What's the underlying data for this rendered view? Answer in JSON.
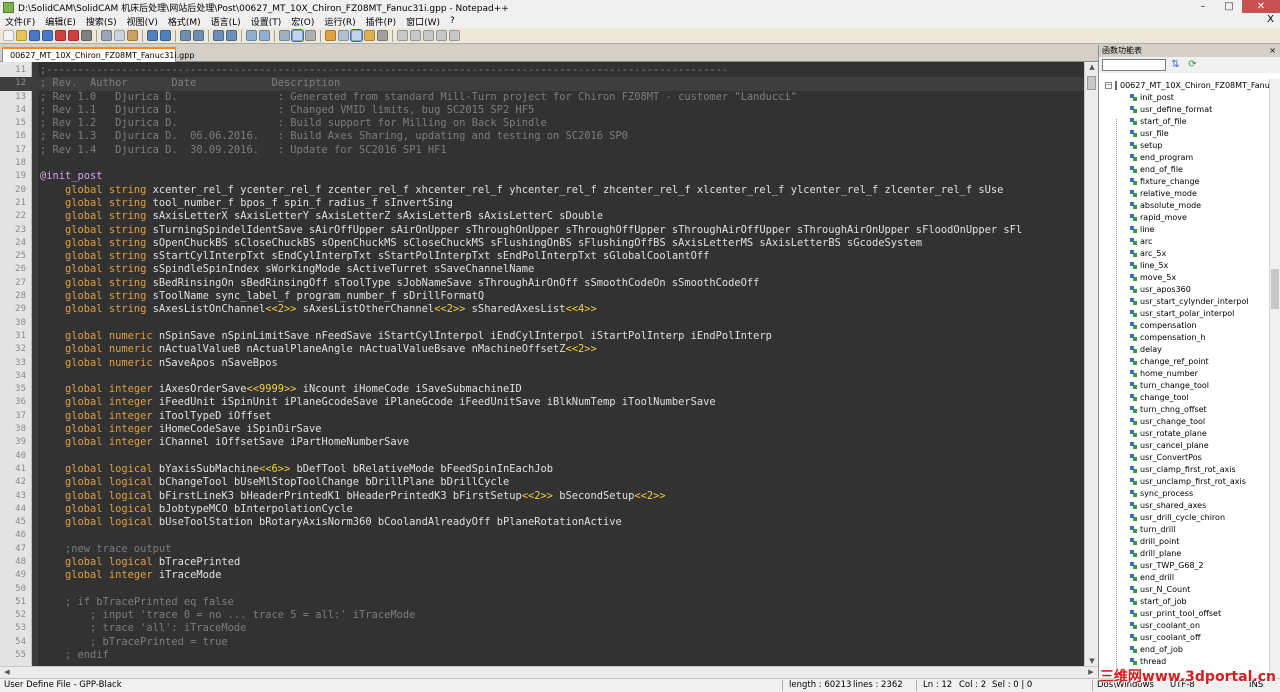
{
  "window": {
    "title": "D:\\SolidCAM\\SolidCAM 机床后处理\\网站后处理\\Post\\00627_MT_10X_Chiron_FZ08MT_Fanuc31i.gpp - Notepad++",
    "min": "–",
    "max": "□",
    "close": "✕"
  },
  "menu": {
    "items": [
      "文件(F)",
      "编辑(E)",
      "搜索(S)",
      "视图(V)",
      "格式(M)",
      "语言(L)",
      "设置(T)",
      "宏(O)",
      "运行(R)",
      "插件(P)",
      "窗口(W)",
      "?"
    ],
    "close": "X"
  },
  "toolbar": {
    "icons": [
      "new-file-icon",
      "open-file-icon",
      "save-icon",
      "save-all-icon",
      "close-icon",
      "close-all-icon",
      "print-icon",
      "sep",
      "cut-icon",
      "copy-icon",
      "paste-icon",
      "sep",
      "undo-icon",
      "redo-icon",
      "sep",
      "find-icon",
      "replace-icon",
      "sep",
      "zoom-in-icon",
      "zoom-out-icon",
      "sep",
      "sync-v-icon",
      "sync-h-icon",
      "sep",
      "wrap-icon",
      "all-chars-icon",
      "indent-guide-icon",
      "sep",
      "user-lang-icon",
      "doc-map-icon",
      "function-list-icon",
      "folder-workspace-icon",
      "monitor-icon",
      "sep",
      "record-macro-icon",
      "stop-record-icon",
      "play-macro-icon",
      "run-macro-icon",
      "save-macro-icon"
    ],
    "active": [
      "all-chars-icon",
      "function-list-icon"
    ],
    "colors": {
      "new-file-icon": "#f4f4f4",
      "open-file-icon": "#e8c45a",
      "save-icon": "#4a78c8",
      "save-all-icon": "#4a78c8",
      "close-icon": "#d04040",
      "close-all-icon": "#d04040",
      "print-icon": "#808080",
      "cut-icon": "#9aa4b4",
      "copy-icon": "#c9d3e4",
      "paste-icon": "#c8a060",
      "undo-icon": "#5080c0",
      "redo-icon": "#5080c0",
      "find-icon": "#7090b0",
      "replace-icon": "#7090b0",
      "zoom-in-icon": "#6a8fb8",
      "zoom-out-icon": "#6a8fb8",
      "sync-v-icon": "#8fb0d0",
      "sync-h-icon": "#8fb0d0",
      "wrap-icon": "#a0b0c0",
      "all-chars-icon": "#d0b060",
      "indent-guide-icon": "#b0b0b0",
      "user-lang-icon": "#e0a040",
      "doc-map-icon": "#b0c0d0",
      "function-list-icon": "#e8d090",
      "folder-workspace-icon": "#e0b050",
      "monitor-icon": "#a0a0a0",
      "record-macro-icon": "#c8c8c8",
      "stop-record-icon": "#c8c8c8",
      "play-macro-icon": "#c8c8c8",
      "run-macro-icon": "#c8c8c8",
      "save-macro-icon": "#c8c8c8"
    }
  },
  "tab": {
    "label": "00627_MT_10X_Chiron_FZ08MT_Fanuc31i.gpp"
  },
  "editor": {
    "lines": [
      {
        "n": "11",
        "segs": [
          [
            "comment",
            ";-------------------------------------------------------------------------------------------------------------"
          ]
        ]
      },
      {
        "n": "12",
        "current": true,
        "segs": [
          [
            "comment",
            "; Rev.  Author       Date            Description"
          ]
        ]
      },
      {
        "n": "13",
        "segs": [
          [
            "comment",
            "; Rev 1.0   Djurica D.                : Generated from standard Mill-Turn project for Chiron FZ08MT - customer \"Landucci\""
          ]
        ]
      },
      {
        "n": "14",
        "segs": [
          [
            "comment",
            "; Rev 1.1   Djurica D.                : Changed VMID limits, bug SC2015 SP2 HF5"
          ]
        ]
      },
      {
        "n": "15",
        "segs": [
          [
            "comment",
            "; Rev 1.2   Djurica D.                : Build support for Milling on Back Spindle"
          ]
        ]
      },
      {
        "n": "16",
        "segs": [
          [
            "comment",
            "; Rev 1.3   Djurica D.  06.06.2016.   : Build Axes Sharing, updating and testing on SC2016 SP0"
          ]
        ]
      },
      {
        "n": "17",
        "segs": [
          [
            "comment",
            "; Rev 1.4   Djurica D.  30.09.2016.   : Update for SC2016 SP1 HF1"
          ]
        ]
      },
      {
        "n": "18",
        "segs": []
      },
      {
        "n": "19",
        "segs": [
          [
            "section",
            "@init_post"
          ]
        ]
      },
      {
        "n": "20",
        "segs": [
          [
            "plain",
            "    "
          ],
          [
            "keyword",
            "global string"
          ],
          [
            "plain",
            " xcenter_rel_f ycenter_rel_f zcenter_rel_f xhcenter_rel_f yhcenter_rel_f zhcenter_rel_f xlcenter_rel_f ylcenter_rel_f zlcenter_rel_f sUse"
          ]
        ]
      },
      {
        "n": "21",
        "segs": [
          [
            "plain",
            "    "
          ],
          [
            "keyword",
            "global string"
          ],
          [
            "plain",
            " tool_number_f bpos_f spin_f radius_f sInvertSing"
          ]
        ]
      },
      {
        "n": "22",
        "segs": [
          [
            "plain",
            "    "
          ],
          [
            "keyword",
            "global string"
          ],
          [
            "plain",
            " sAxisLetterX sAxisLetterY sAxisLetterZ sAxisLetterB sAxisLetterC sDouble"
          ]
        ]
      },
      {
        "n": "23",
        "segs": [
          [
            "plain",
            "    "
          ],
          [
            "keyword",
            "global string"
          ],
          [
            "plain",
            " sTurningSpindelIdentSave sAirOffUpper sAirOnUpper sThroughOnUpper sThroughOffUpper sThroughAirOffUpper sThroughAirOnUpper sFloodOnUpper sFl"
          ]
        ]
      },
      {
        "n": "24",
        "segs": [
          [
            "plain",
            "    "
          ],
          [
            "keyword",
            "global string"
          ],
          [
            "plain",
            " sOpenChuckBS sCloseChuckBS sOpenChuckMS sCloseChuckMS sFlushingOnBS sFlushingOffBS sAxisLetterMS sAxisLetterBS sGcodeSystem"
          ]
        ]
      },
      {
        "n": "25",
        "segs": [
          [
            "plain",
            "    "
          ],
          [
            "keyword",
            "global string"
          ],
          [
            "plain",
            " sStartCylInterpTxt sEndCylInterpTxt sStartPolInterpTxt sEndPolInterpTxt sGlobalCoolantOff"
          ]
        ]
      },
      {
        "n": "26",
        "segs": [
          [
            "plain",
            "    "
          ],
          [
            "keyword",
            "global string"
          ],
          [
            "plain",
            " sSpindleSpinIndex sWorkingMode sActiveTurret sSaveChannelName"
          ]
        ]
      },
      {
        "n": "27",
        "segs": [
          [
            "plain",
            "    "
          ],
          [
            "keyword",
            "global string"
          ],
          [
            "plain",
            " sBedRinsingOn sBedRinsingOff sToolType sJobNameSave sThroughAirOnOff sSmoothCodeOn sSmoothCodeOff"
          ]
        ]
      },
      {
        "n": "28",
        "segs": [
          [
            "plain",
            "    "
          ],
          [
            "keyword",
            "global string"
          ],
          [
            "plain",
            " sToolName sync_label_f program_number_f sDrillFormatQ"
          ]
        ]
      },
      {
        "n": "29",
        "segs": [
          [
            "plain",
            "    "
          ],
          [
            "keyword",
            "global string"
          ],
          [
            "plain",
            " sAxesListOnChannel"
          ],
          [
            "op",
            "<<2>>"
          ],
          [
            "plain",
            " sAxesListOtherChannel"
          ],
          [
            "op",
            "<<2>>"
          ],
          [
            "plain",
            " sSharedAxesList"
          ],
          [
            "op",
            "<<4>>"
          ]
        ]
      },
      {
        "n": "30",
        "segs": []
      },
      {
        "n": "31",
        "segs": [
          [
            "plain",
            "    "
          ],
          [
            "keyword",
            "global numeric"
          ],
          [
            "plain",
            " nSpinSave nSpinLimitSave nFeedSave iStartCylInterpol iEndCylInterpol iStartPolInterp iEndPolInterp"
          ]
        ]
      },
      {
        "n": "32",
        "segs": [
          [
            "plain",
            "    "
          ],
          [
            "keyword",
            "global numeric"
          ],
          [
            "plain",
            " nActualValueB nActualPlaneAngle nActualValueBsave nMachineOffsetZ"
          ],
          [
            "op",
            "<<2>>"
          ]
        ]
      },
      {
        "n": "33",
        "segs": [
          [
            "plain",
            "    "
          ],
          [
            "keyword",
            "global numeric"
          ],
          [
            "plain",
            " nSaveApos nSaveBpos"
          ]
        ]
      },
      {
        "n": "34",
        "segs": []
      },
      {
        "n": "35",
        "segs": [
          [
            "plain",
            "    "
          ],
          [
            "keyword",
            "global integer"
          ],
          [
            "plain",
            " iAxesOrderSave"
          ],
          [
            "op",
            "<<9999>>"
          ],
          [
            "plain",
            " iNcount iHomeCode iSaveSubmachineID"
          ]
        ]
      },
      {
        "n": "36",
        "segs": [
          [
            "plain",
            "    "
          ],
          [
            "keyword",
            "global integer"
          ],
          [
            "plain",
            " iFeedUnit iSpinUnit iPlaneGcodeSave iPlaneGcode iFeedUnitSave iBlkNumTemp iToolNumberSave"
          ]
        ]
      },
      {
        "n": "37",
        "segs": [
          [
            "plain",
            "    "
          ],
          [
            "keyword",
            "global integer"
          ],
          [
            "plain",
            " iToolTypeD iOffset"
          ]
        ]
      },
      {
        "n": "38",
        "segs": [
          [
            "plain",
            "    "
          ],
          [
            "keyword",
            "global integer"
          ],
          [
            "plain",
            " iHomeCodeSave iSpinDirSave"
          ]
        ]
      },
      {
        "n": "39",
        "segs": [
          [
            "plain",
            "    "
          ],
          [
            "keyword",
            "global integer"
          ],
          [
            "plain",
            " iChannel iOffsetSave iPartHomeNumberSave"
          ]
        ]
      },
      {
        "n": "40",
        "segs": []
      },
      {
        "n": "41",
        "segs": [
          [
            "plain",
            "    "
          ],
          [
            "keyword",
            "global logical"
          ],
          [
            "plain",
            " bYaxisSubMachine"
          ],
          [
            "op",
            "<<6>>"
          ],
          [
            "plain",
            " bDefTool bRelativeMode bFeedSpinInEachJob"
          ]
        ]
      },
      {
        "n": "42",
        "segs": [
          [
            "plain",
            "    "
          ],
          [
            "keyword",
            "global logical"
          ],
          [
            "plain",
            " bChangeTool bUseMlStopToolChange bDrillPlane bDrillCycle"
          ]
        ]
      },
      {
        "n": "43",
        "segs": [
          [
            "plain",
            "    "
          ],
          [
            "keyword",
            "global logical"
          ],
          [
            "plain",
            " bFirstLineK3 bHeaderPrintedK1 bHeaderPrintedK3 bFirstSetup"
          ],
          [
            "op",
            "<<2>>"
          ],
          [
            "plain",
            " bSecondSetup"
          ],
          [
            "op",
            "<<2>>"
          ]
        ]
      },
      {
        "n": "44",
        "segs": [
          [
            "plain",
            "    "
          ],
          [
            "keyword",
            "global logical"
          ],
          [
            "plain",
            " bJobtypeMCO bInterpolationCycle"
          ]
        ]
      },
      {
        "n": "45",
        "segs": [
          [
            "plain",
            "    "
          ],
          [
            "keyword",
            "global logical"
          ],
          [
            "plain",
            " bUseToolStation bRotaryAxisNorm360 bCoolandAlreadyOff bPlaneRotationActive"
          ]
        ]
      },
      {
        "n": "46",
        "segs": []
      },
      {
        "n": "47",
        "segs": [
          [
            "plain",
            "    "
          ],
          [
            "comment",
            ";new trace output"
          ]
        ]
      },
      {
        "n": "48",
        "segs": [
          [
            "plain",
            "    "
          ],
          [
            "keyword",
            "global logical"
          ],
          [
            "plain",
            " bTracePrinted"
          ]
        ]
      },
      {
        "n": "49",
        "segs": [
          [
            "plain",
            "    "
          ],
          [
            "keyword",
            "global integer"
          ],
          [
            "plain",
            " iTraceMode"
          ]
        ]
      },
      {
        "n": "50",
        "segs": []
      },
      {
        "n": "51",
        "segs": [
          [
            "plain",
            "    "
          ],
          [
            "comment",
            "; if bTracePrinted eq false"
          ]
        ]
      },
      {
        "n": "52",
        "segs": [
          [
            "plain",
            "        "
          ],
          [
            "comment",
            "; input 'trace 0 = no ... trace 5 = all:' iTraceMode"
          ]
        ]
      },
      {
        "n": "53",
        "segs": [
          [
            "plain",
            "        "
          ],
          [
            "comment",
            "; trace 'all': iTraceMode"
          ]
        ]
      },
      {
        "n": "54",
        "segs": [
          [
            "plain",
            "        "
          ],
          [
            "comment",
            "; bTracePrinted = true"
          ]
        ]
      },
      {
        "n": "55",
        "segs": [
          [
            "plain",
            "    "
          ],
          [
            "comment",
            "; endif"
          ]
        ]
      }
    ]
  },
  "function_list": {
    "title": "函数功能表",
    "close": "×",
    "search_placeholder": "",
    "root": "00627_MT_10X_Chiron_FZ08MT_Fanuc31i.gpp",
    "items": [
      "init_post",
      "usr_define_format",
      "start_of_file",
      "usr_file",
      "setup",
      "end_program",
      "end_of_file",
      "fixture_change",
      "relative_mode",
      "absolute_mode",
      "rapid_move",
      "line",
      "arc",
      "arc_5x",
      "line_5x",
      "move_5x",
      "usr_apos360",
      "usr_start_cylynder_interpol",
      "usr_start_polar_interpol",
      "compensation",
      "compensation_h",
      "delay",
      "change_ref_point",
      "home_number",
      "turn_change_tool",
      "change_tool",
      "turn_chng_offset",
      "usr_change_tool",
      "usr_rotate_plane",
      "usr_cancel_plane",
      "usr_ConvertPos",
      "usr_clamp_first_rot_axis",
      "usr_unclamp_first_rot_axis",
      "sync_process",
      "usr_shared_axes",
      "usr_drill_cycle_chiron",
      "turn_drill",
      "drill_point",
      "drill_plane",
      "usr_TWP_G68_2",
      "end_drill",
      "usr_N_Count",
      "start_of_job",
      "usr_print_tool_offset",
      "usr_coolant_on",
      "usr_coolant_off",
      "end_of_job",
      "thread"
    ]
  },
  "status": {
    "lang": "User Define File - GPP-Black",
    "length": "length : 60213",
    "lines": "lines : 2362",
    "ln": "Ln : 12",
    "col": "Col : 2",
    "sel": "Sel : 0 | 0",
    "eol": "Dos\\Windows",
    "enc": "UTF-8",
    "mode": "INS"
  },
  "watermark": "三维网www.3dportal.cn",
  "colors": {
    "editor_bg": "#323232",
    "comment": "#7d7d7d",
    "keyword": "#e0a040",
    "section": "#d8a4e8",
    "operator": "#f0d040",
    "tab_accent": "#fa8c1e"
  }
}
